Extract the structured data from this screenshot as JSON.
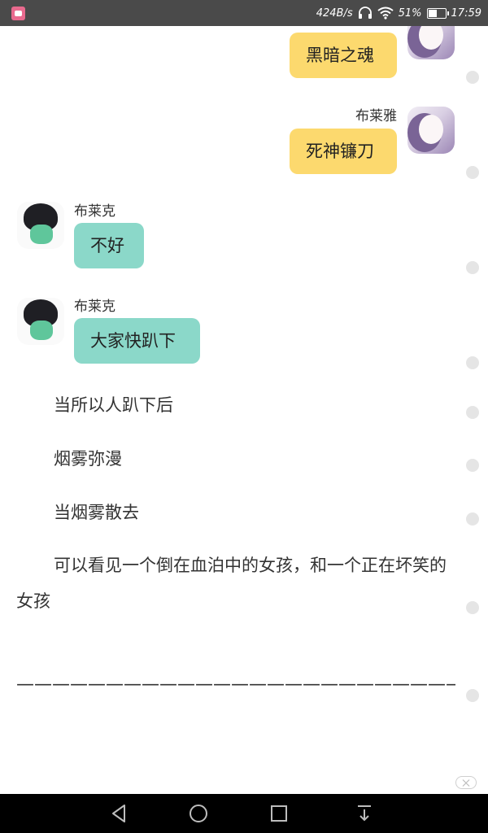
{
  "status_bar": {
    "network_speed": "424B/s",
    "battery_percent": "51%",
    "battery_level": 0.51,
    "time": "17:59",
    "icons": [
      "app-notification-icon",
      "headphones-icon",
      "wifi-icon",
      "battery-icon"
    ]
  },
  "chat": {
    "messages": [
      {
        "side": "right",
        "sender": "",
        "text": "黑暗之魂"
      },
      {
        "side": "right",
        "sender": "布莱雅",
        "text": "死神镰刀"
      },
      {
        "side": "left",
        "sender": "布莱克",
        "text": "不好"
      },
      {
        "side": "left",
        "sender": "布莱克",
        "text": "大家快趴下"
      }
    ]
  },
  "narration": {
    "lines": [
      "当所以人趴下后",
      "烟雾弥漫",
      "当烟雾散去",
      "可以看见一个倒在血泊中的女孩，和一个正在坏笑的女孩"
    ],
    "divider": "——————————————————————————————"
  },
  "colors": {
    "status_bar": "#4a4a4a",
    "my_bubble": "#fcd96e",
    "other_bubble": "#8bd8c9",
    "nav_bar": "#000000"
  },
  "navigation": {
    "buttons": [
      "back-icon",
      "home-icon",
      "recents-icon",
      "notification-pull-icon"
    ]
  }
}
